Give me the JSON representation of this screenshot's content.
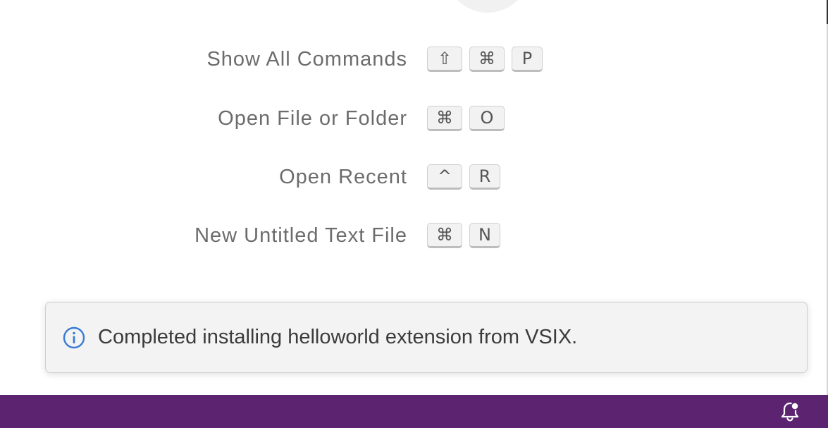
{
  "shortcuts": [
    {
      "label": "Show All Commands",
      "keys": [
        "⇧",
        "⌘",
        "P"
      ]
    },
    {
      "label": "Open File or Folder",
      "keys": [
        "⌘",
        "O"
      ]
    },
    {
      "label": "Open Recent",
      "keys": [
        "^",
        "R"
      ]
    },
    {
      "label": "New Untitled Text File",
      "keys": [
        "⌘",
        "N"
      ]
    }
  ],
  "notification": {
    "icon": "info-icon",
    "message": "Completed installing helloworld extension from VSIX."
  },
  "status_bar": {
    "background": "#5c2371",
    "bell_icon": "notification-bell-with-dot-icon"
  },
  "colors": {
    "info_accent": "#3a7bd5"
  }
}
